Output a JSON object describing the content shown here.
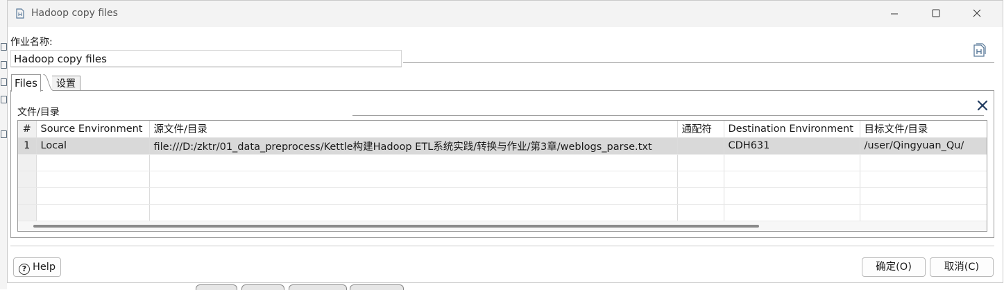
{
  "window": {
    "title": "Hadoop copy files",
    "controls": [
      "minimize",
      "maximize",
      "close"
    ]
  },
  "job_name": {
    "label": "作业名称:",
    "value": "Hadoop copy files"
  },
  "tabs": [
    {
      "label": "Files",
      "active": true
    },
    {
      "label": "设置",
      "active": false
    }
  ],
  "files_group": {
    "label": "文件/目录",
    "columns": [
      "#",
      "Source Environment",
      "源文件/目录",
      "通配符",
      "Destination Environment",
      "目标文件/目录"
    ],
    "rows": [
      {
        "num": "1",
        "source_env": "Local",
        "source_path": "file:///D:/zktr/01_data_preprocess/Kettle构建Hadoop ETL系统实践/转换与作业/第3章/weblogs_parse.txt",
        "wildcard": "",
        "dest_env": "CDH631",
        "dest_path": "/user/Qingyuan_Qu/"
      }
    ]
  },
  "buttons": {
    "help": "Help",
    "ok": "确定(O)",
    "cancel": "取消(C)"
  },
  "icons": [
    "document-icon",
    "hadoop-doc-icon",
    "close-icon",
    "help-icon"
  ],
  "colors": {
    "selected_row": "#d9d9d9",
    "titlebar": "#f3f3f3",
    "border": "#9a9a9a"
  }
}
